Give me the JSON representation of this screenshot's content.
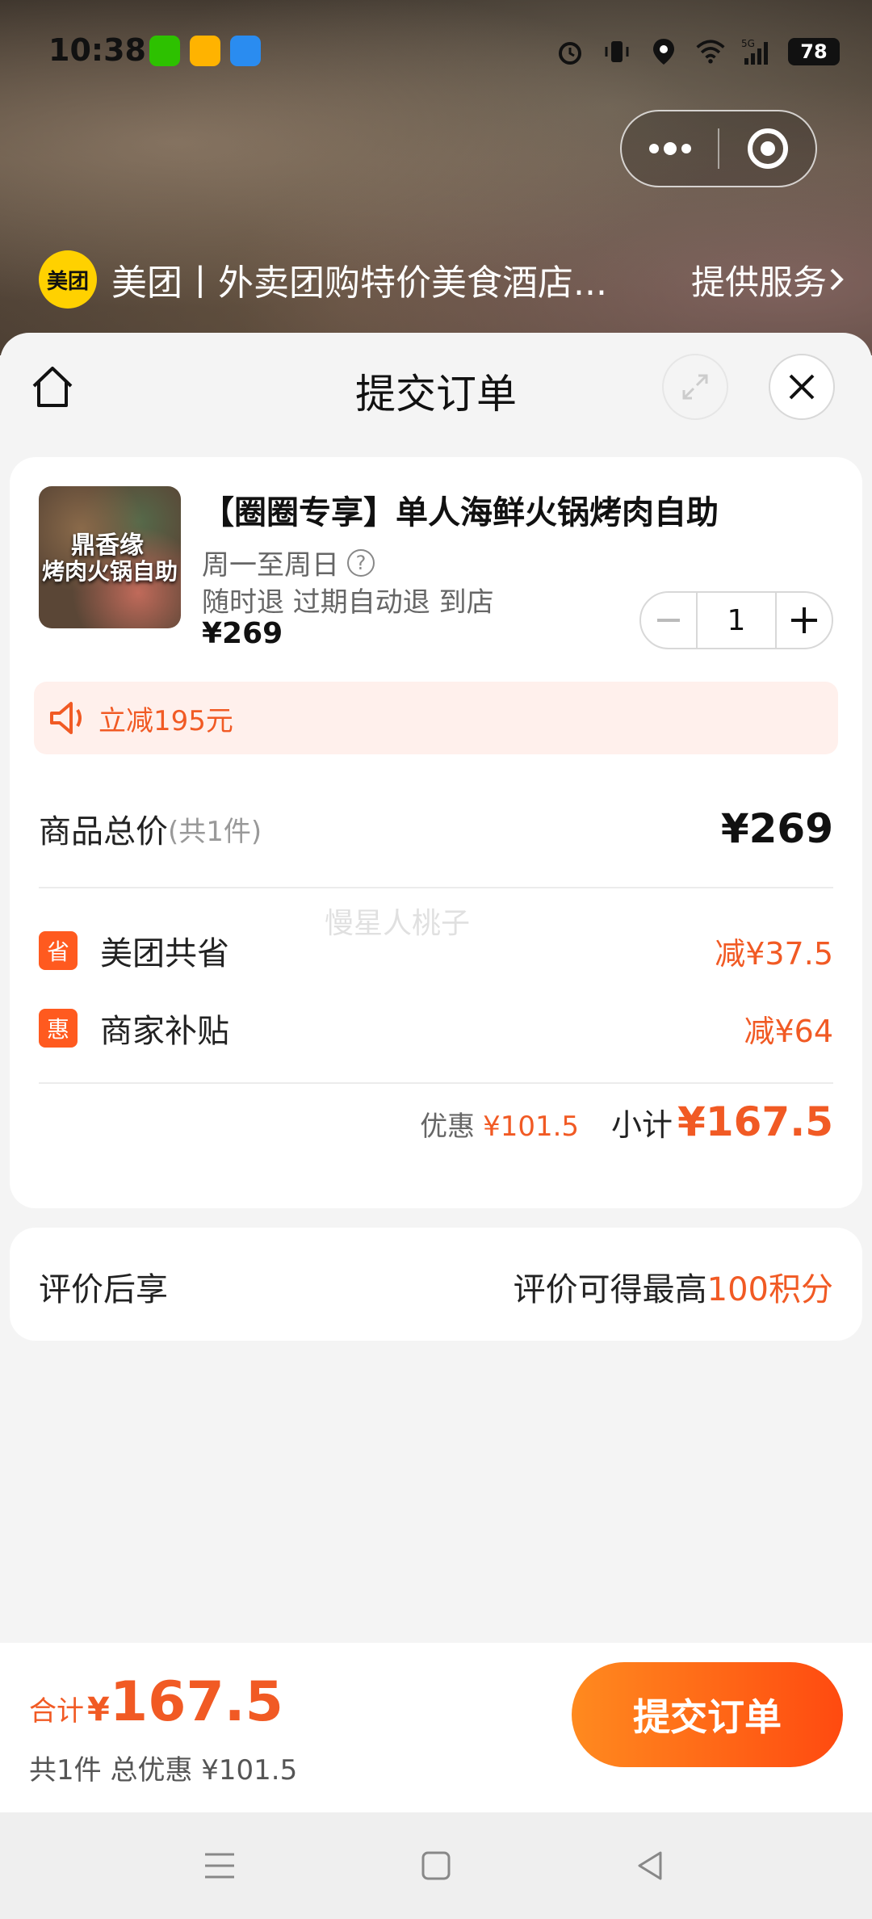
{
  "status_bar": {
    "time": "10:38",
    "battery": "78",
    "network": "5G"
  },
  "miniprogram": {
    "logo_text": "美团",
    "title": "美团丨外卖团购特价美食酒店...",
    "service_label": "提供服务"
  },
  "sheet": {
    "title": "提交订单"
  },
  "product": {
    "image_text_1": "鼎香缘",
    "image_text_2": "烤肉火锅自助",
    "title": "【圈圈专享】单人海鲜火锅烤肉自助",
    "days": "周一至周日",
    "policy": "随时退 过期自动退 到店",
    "price": "¥269",
    "quantity": "1"
  },
  "promo": {
    "text": "立减195元"
  },
  "summary": {
    "total_label": "商品总价",
    "total_count": "(共1件)",
    "total_amount": "¥269",
    "watermark": "慢星人桃子",
    "discounts": [
      {
        "badge": "省",
        "label": "美团共省",
        "amount": "减¥37.5"
      },
      {
        "badge": "惠",
        "label": "商家补贴",
        "amount": "减¥64"
      }
    ],
    "discount_label": "优惠",
    "discount_value": "¥101.5",
    "subtotal_label": "小计",
    "subtotal_value": "¥167.5"
  },
  "review": {
    "left": "评价后享",
    "right_prefix": "评价可得最高",
    "right_highlight": "100积分"
  },
  "footer": {
    "total_label": "合计",
    "currency": "¥",
    "total_value": "167.5",
    "summary": "共1件 总优惠 ¥101.5",
    "submit_label": "提交订单"
  },
  "colors": {
    "accent": "#f15a24",
    "button_start": "#ff8a1f",
    "button_end": "#ff4a10",
    "logo_yellow": "#ffd100"
  }
}
